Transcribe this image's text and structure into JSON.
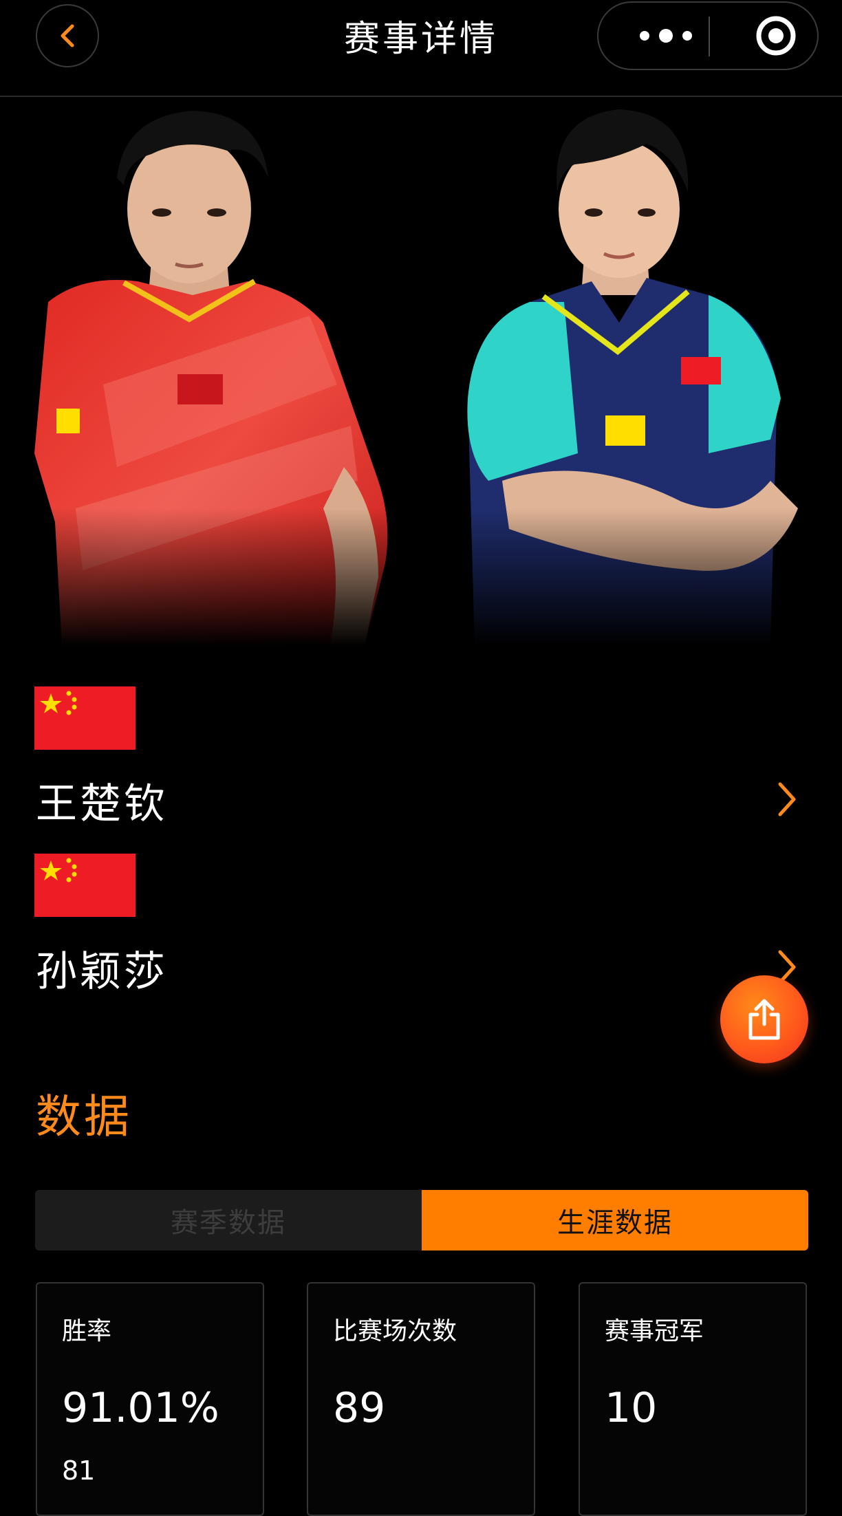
{
  "header": {
    "title": "赛事详情",
    "back_icon": "chevron-left-icon",
    "more_icon": "more-dots-icon",
    "target_icon": "target-icon"
  },
  "players": [
    {
      "name": "王楚钦",
      "flag": "china-flag-icon",
      "jersey_color": "#d8231f"
    },
    {
      "name": "孙颖莎",
      "flag": "china-flag-icon",
      "jersey_color": "#1e2b6b"
    }
  ],
  "section": {
    "title": "数据"
  },
  "tabs": [
    {
      "label": "赛季数据",
      "active": false
    },
    {
      "label": "生涯数据",
      "active": true
    }
  ],
  "stats": [
    {
      "label": "胜率",
      "value": "91.01%",
      "sub": "81"
    },
    {
      "label": "比赛场次数",
      "value": "89"
    },
    {
      "label": "赛事冠军",
      "value": "10"
    }
  ],
  "colors": {
    "accent": "#ff7e00",
    "background": "#000000",
    "flag_red": "#ee1c25",
    "flag_yellow": "#ffde00"
  }
}
